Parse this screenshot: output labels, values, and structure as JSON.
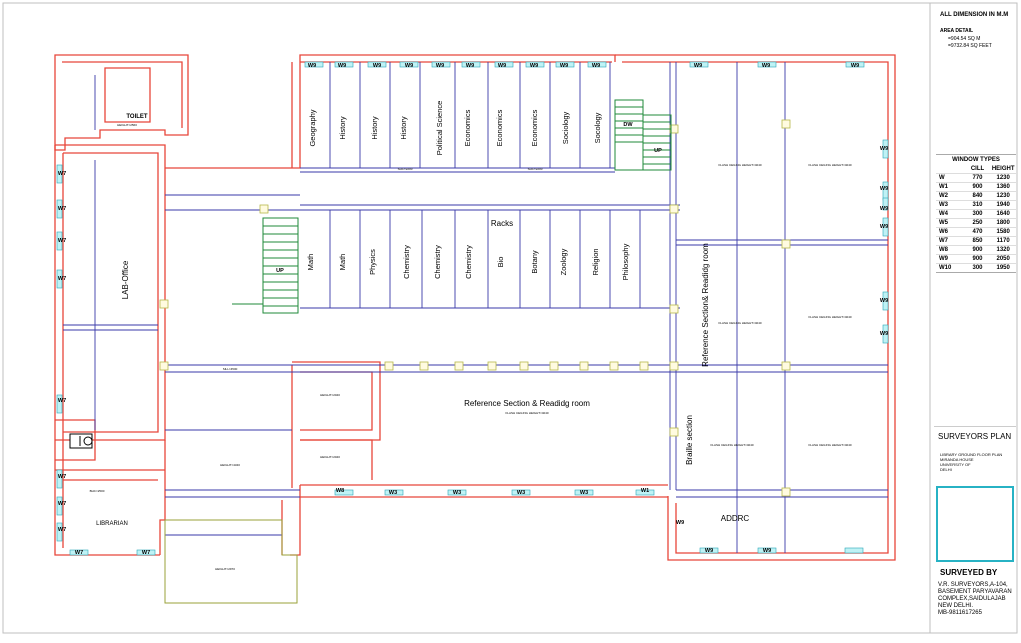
{
  "title_block": {
    "dimension_note": "ALL DIMENSION IN M.M",
    "area_title": "AREA DETAIL",
    "area_sqm": "=904.54 SQ M",
    "area_sqft": "=9732.84 SQ FEET",
    "window_types_title": "WINDOW TYPES",
    "window_headers": [
      "",
      "CILL",
      "HEIGHT"
    ],
    "window_rows": [
      [
        "W",
        "770",
        "1230"
      ],
      [
        "W1",
        "900",
        "1360"
      ],
      [
        "W2",
        "840",
        "1230"
      ],
      [
        "W3",
        "310",
        "1940"
      ],
      [
        "W4",
        "300",
        "1640"
      ],
      [
        "W5",
        "250",
        "1800"
      ],
      [
        "W6",
        "470",
        "1580"
      ],
      [
        "W7",
        "850",
        "1170"
      ],
      [
        "W8",
        "900",
        "1320"
      ],
      [
        "W9",
        "900",
        "2050"
      ],
      [
        "W10",
        "300",
        "1950"
      ]
    ],
    "surveyors_plan": "SURVEYORS PLAN",
    "project_lines": [
      "LIBRARY GROUND FLOOR PLAN",
      "MIRANDA HOUSE",
      "UNIVERSITY OF",
      "DELHI"
    ],
    "surveyed_by": "SURVEYED BY",
    "surveyor_lines": [
      "V.R. SURVEYORS,A-104,",
      "BASEMENT PARYAVARAN",
      "COMPLEX,SAIDULAJAB",
      "NEW DELHI.",
      "MB-9811617265"
    ]
  },
  "plan": {
    "room_labels": {
      "toilet": "TOILET",
      "lab_office": "LAB-Office",
      "librarian": "LIBRARIAN",
      "racks": "Racks",
      "reference_reading": "Reference Section & Readidg room",
      "reference_reading_vertical": "Reference Section& Readidg room",
      "braille": "Braille section",
      "addrc": "ADDRC"
    },
    "stair_labels": {
      "up": "UP",
      "dw": "DW"
    },
    "rack_top_labels": [
      "Geography",
      "History",
      "History",
      "History",
      "Political Science",
      "Economics",
      "Economics",
      "Economics",
      "Sociology",
      "Socology"
    ],
    "rack_bottom_labels": [
      "Math",
      "Math",
      "Physics",
      "Chemistry",
      "Chemistry",
      "Chemistry",
      "Bio",
      "Botany",
      "Zoology",
      "Religion",
      "Philosophy"
    ],
    "window_tags_top": [
      "W9",
      "W9",
      "W9",
      "W9",
      "W9",
      "W9",
      "W9",
      "W9",
      "W9",
      "W9",
      "W9",
      "W9",
      "W9"
    ],
    "window_tags_right": [
      "W9",
      "W9",
      "W9",
      "W9",
      "W9",
      "W9"
    ],
    "window_tags_left": [
      "W7",
      "W7",
      "W7",
      "W7",
      "W7",
      "W7",
      "W7",
      "W7"
    ],
    "window_tags_bottom": [
      "W8",
      "W3",
      "W3",
      "W3",
      "W3",
      "W1",
      "W9",
      "W9",
      "W9"
    ],
    "librarian_windows": [
      "W7",
      "W7"
    ],
    "small_notes": {
      "flash_ceiling": "FLASH CEILING  HEIGHT=4040",
      "height_2560": "HEIGHT=2560",
      "height_4340": "HEIGHT=4340",
      "height_2970": "HEIGHT=2970",
      "height_2040": "HEIGHT=2040",
      "sh_2200": "SHC=2200",
      "bhc_2500": "BHC=2500",
      "sill": "SILL=4500"
    }
  }
}
